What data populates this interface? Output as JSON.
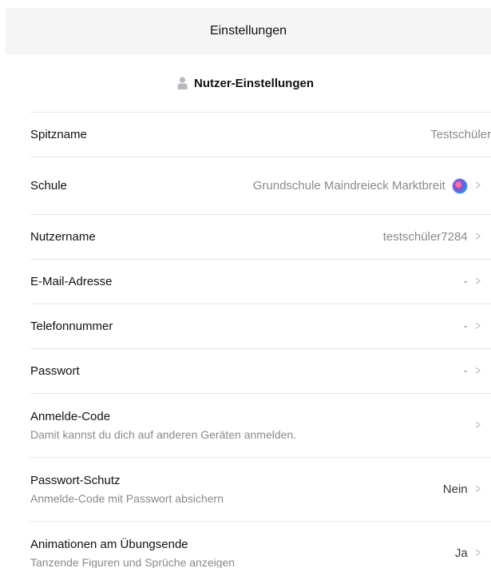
{
  "header": {
    "title": "Einstellungen"
  },
  "section": {
    "title": "Nutzer-Einstellungen",
    "icon": "user-icon"
  },
  "rows": {
    "nickname": {
      "label": "Spitzname",
      "value": "Testschüler"
    },
    "school": {
      "label": "Schule",
      "value": "Grundschule Maindreieck Marktbreit",
      "icon": "school-badge-icon"
    },
    "username": {
      "label": "Nutzername",
      "value": "testschüler7284"
    },
    "email": {
      "label": "E-Mail-Adresse",
      "value": "-"
    },
    "phone": {
      "label": "Telefonnummer",
      "value": "-"
    },
    "password": {
      "label": "Passwort",
      "value": "-"
    },
    "login_code": {
      "label": "Anmelde-Code",
      "sub": "Damit kannst du dich auf anderen Geräten anmelden."
    },
    "password_protection": {
      "label": "Passwort-Schutz",
      "sub": "Anmelde-Code mit Passwort absichern",
      "value": "Nein"
    },
    "animations": {
      "label": "Animationen am Übungsende",
      "sub": "Tanzende Figuren und Sprüche anzeigen",
      "value": "Ja"
    }
  },
  "chevron_glyph": ">"
}
